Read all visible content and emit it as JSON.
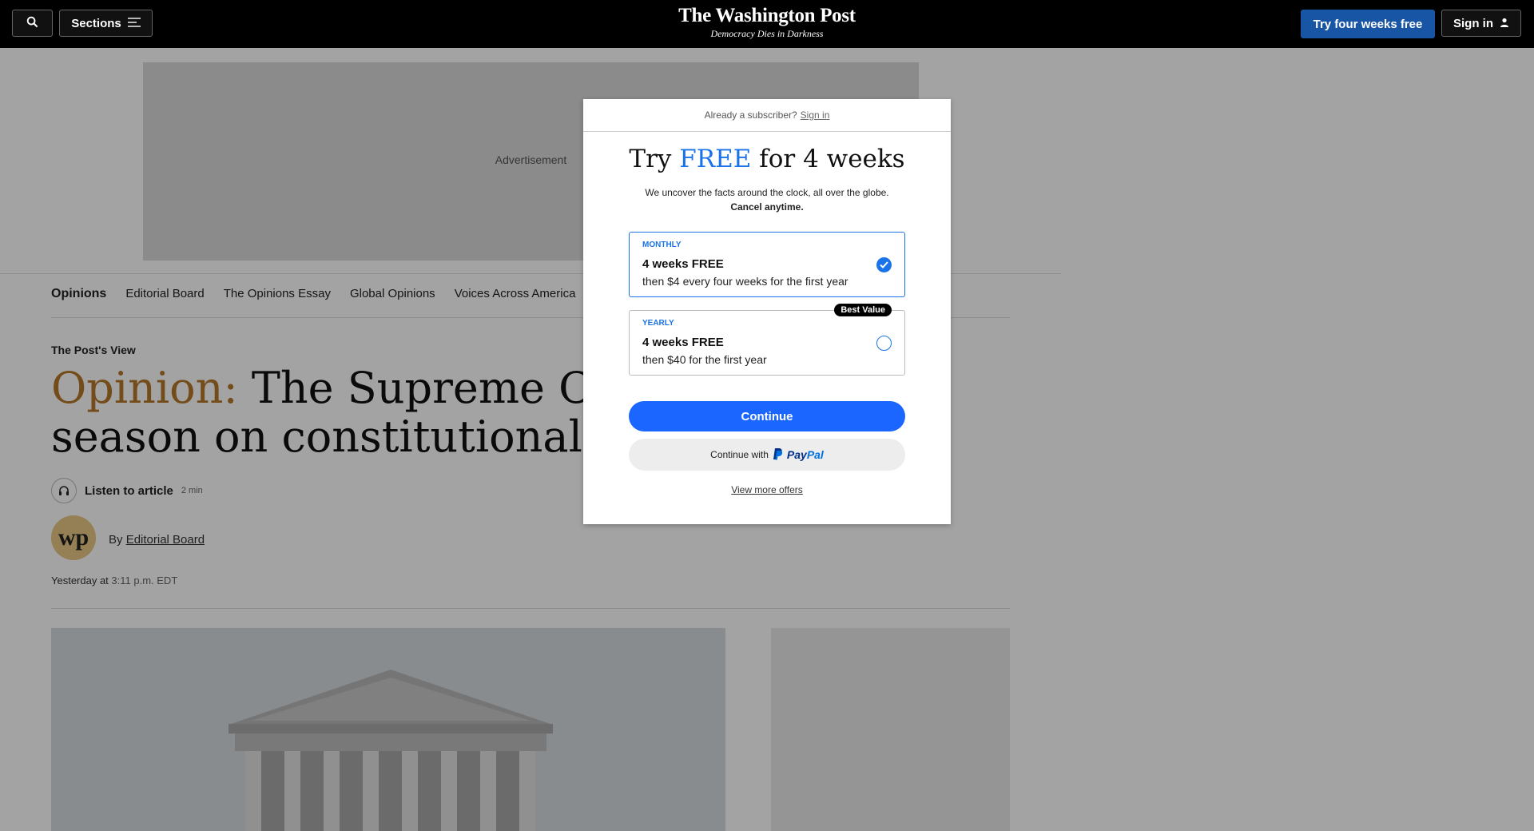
{
  "header": {
    "sections_label": "Sections",
    "logo": "The Washington Post",
    "tagline": "Democracy Dies in Darkness",
    "try_label": "Try four weeks free",
    "signin_label": "Sign in"
  },
  "ad": {
    "label": "Advertisement"
  },
  "subnav": {
    "items": [
      "Opinions",
      "Editorial Board",
      "The Opinions Essay",
      "Global Opinions",
      "Voices Across America"
    ]
  },
  "article": {
    "kicker": "The Post's View",
    "headline_prefix": "Opinion:",
    "headline_line1": "The Supreme Cour",
    "headline_line2": "season on constitutional righ",
    "listen_label": "Listen to article",
    "listen_duration": "2 min",
    "avatar_initials": "wp",
    "byline_prefix": "By",
    "byline_author": "Editorial Board",
    "date_prefix": "Yesterday at",
    "date_time": "3:11 p.m. EDT"
  },
  "modal": {
    "already_text": "Already a subscriber?",
    "signin_link": "Sign in",
    "title_pre": "Try",
    "title_free": "FREE",
    "title_post": "for 4 weeks",
    "subtitle": "We uncover the facts around the clock, all over the globe.",
    "subtitle_bold": "Cancel anytime.",
    "plans": [
      {
        "type": "MONTHLY",
        "main": "4 weeks FREE",
        "desc": "then $4 every four weeks for the first year",
        "selected": true
      },
      {
        "type": "YEARLY",
        "main": "4 weeks FREE",
        "desc": "then $40 for the first year",
        "badge": "Best Value",
        "selected": false
      }
    ],
    "continue_label": "Continue",
    "paypal_prefix": "Continue with",
    "paypal_brand_pay": "Pay",
    "paypal_brand_pal": "Pal",
    "more_offers": "View more offers"
  },
  "colors": {
    "accent_blue": "#1a73e8",
    "header_cta": "#1955a5",
    "opinion_gold": "#b5772a"
  }
}
